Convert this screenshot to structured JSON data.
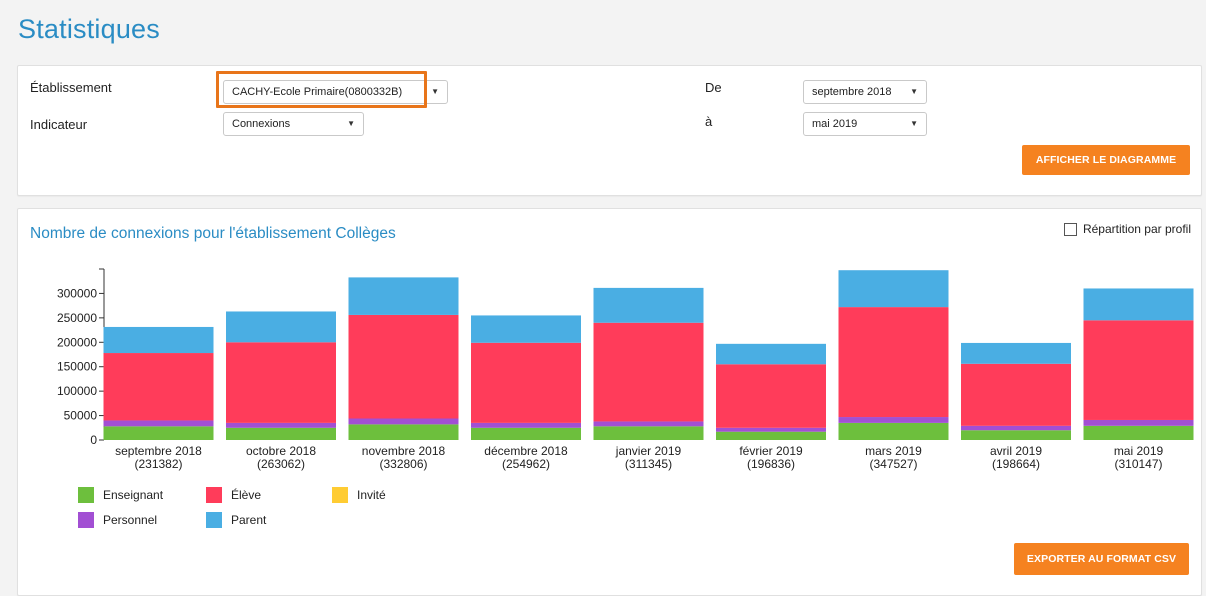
{
  "page": {
    "title": "Statistiques"
  },
  "filters": {
    "etablissement_label": "Établissement",
    "etablissement_value": "CACHY-Ecole Primaire(0800332B)",
    "indicateur_label": "Indicateur",
    "indicateur_value": "Connexions",
    "de_label": "De",
    "de_value": "septembre 2018",
    "a_label": "à",
    "a_value": "mai 2019",
    "show_chart_button": "AFFICHER LE DIAGRAMME"
  },
  "chart_panel": {
    "title": "Nombre de connexions pour l'établissement Collèges",
    "repartition_label": "Répartition par profil",
    "export_button": "EXPORTER AU FORMAT CSV"
  },
  "colors": {
    "Enseignant": "#6dbf3d",
    "Personnel": "#a24fd3",
    "Élève": "#ff3c5a",
    "Parent": "#4aaee3",
    "Invité": "#ffcc33",
    "accent": "#f58220",
    "title": "#2a8cc4"
  },
  "chart_data": {
    "type": "bar",
    "stacked": true,
    "title": "Nombre de connexions pour l'établissement Collèges",
    "ylim": [
      0,
      350000
    ],
    "yticks": [
      0,
      50000,
      100000,
      150000,
      200000,
      250000,
      300000
    ],
    "categories": [
      "septembre 2018",
      "octobre 2018",
      "novembre 2018",
      "décembre 2018",
      "janvier 2019",
      "février 2019",
      "mars 2019",
      "avril 2019",
      "mai 2019"
    ],
    "totals": [
      "(231382)",
      "(263062)",
      "(332806)",
      "(254962)",
      "(311345)",
      "(196836)",
      "(347527)",
      "(198664)",
      "(310147)"
    ],
    "series": [
      {
        "name": "Enseignant",
        "values": [
          28000,
          25000,
          32000,
          25000,
          28000,
          17000,
          35000,
          20000,
          29000
        ]
      },
      {
        "name": "Personnel",
        "values": [
          12000,
          10000,
          12000,
          10000,
          10000,
          8000,
          12000,
          9000,
          12000
        ]
      },
      {
        "name": "Élève",
        "values": [
          138000,
          165000,
          212000,
          164000,
          202000,
          130000,
          225000,
          127000,
          204000
        ]
      },
      {
        "name": "Invité",
        "values": [
          0,
          0,
          0,
          0,
          0,
          0,
          0,
          0,
          0
        ]
      },
      {
        "name": "Parent",
        "values": [
          53382,
          63062,
          76806,
          55962,
          71345,
          41836,
          75527,
          42664,
          65147
        ]
      }
    ],
    "legend": [
      {
        "name": "Enseignant",
        "icon": "green-square"
      },
      {
        "name": "Élève",
        "icon": "red-square"
      },
      {
        "name": "Invité",
        "icon": "yellow-square"
      },
      {
        "name": "Personnel",
        "icon": "purple-square"
      },
      {
        "name": "Parent",
        "icon": "blue-square"
      }
    ],
    "grid": false,
    "legend_position": "bottom-left"
  }
}
